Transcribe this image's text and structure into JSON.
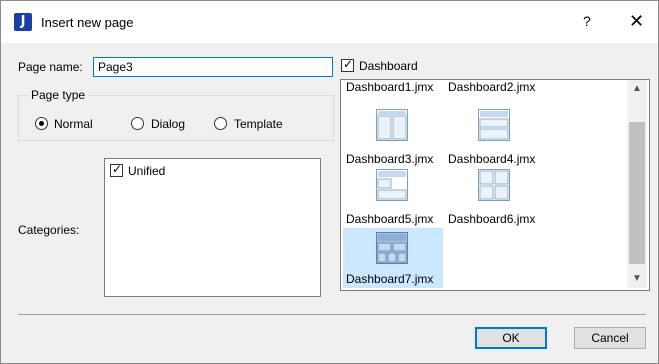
{
  "window": {
    "title": "Insert new page",
    "help_label": "?",
    "close_label": "✕",
    "app_icon": "J"
  },
  "form": {
    "page_name_label": "Page name:",
    "page_name_value": "Page3",
    "page_type_label": "Page type",
    "page_types": [
      {
        "label": "Normal",
        "selected": true
      },
      {
        "label": "Dialog",
        "selected": false
      },
      {
        "label": "Template",
        "selected": false
      }
    ],
    "categories_label": "Categories:",
    "categories": [
      {
        "label": "Unified",
        "checked": true
      }
    ]
  },
  "gallery": {
    "filter_label": "Dashboard",
    "filter_checked": true,
    "items": [
      {
        "label": "Dashboard1.jmx",
        "layout": "top-bar"
      },
      {
        "label": "Dashboard2.jmx",
        "layout": "top-bar"
      },
      {
        "label": "Dashboard3.jmx",
        "layout": "two-columns"
      },
      {
        "label": "Dashboard4.jmx",
        "layout": "header-two-rows"
      },
      {
        "label": "Dashboard5.jmx",
        "layout": "header-rows"
      },
      {
        "label": "Dashboard6.jmx",
        "layout": "quad"
      },
      {
        "label": "Dashboard7.jmx",
        "layout": "header-grid",
        "selected": true
      }
    ]
  },
  "buttons": {
    "ok": "OK",
    "cancel": "Cancel"
  },
  "colors": {
    "accent": "#0078d7",
    "selection": "#cce8ff",
    "app_icon": "#1b3fa8"
  }
}
